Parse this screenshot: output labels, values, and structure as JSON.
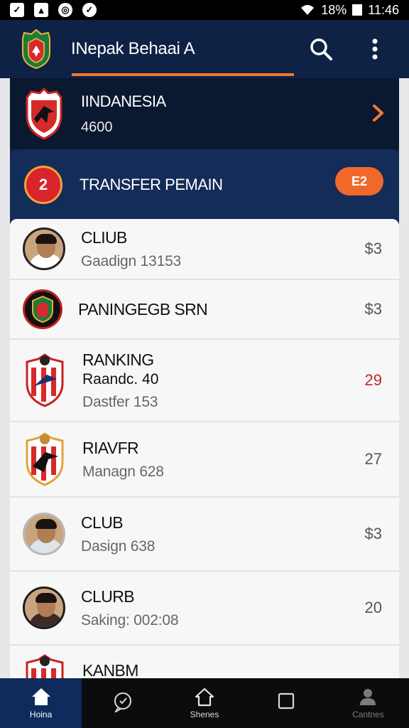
{
  "status_bar": {
    "battery_percent": "18%",
    "time": "11:46"
  },
  "header": {
    "title": "INepak Behaai A",
    "search_icon": "search-icon",
    "menu_icon": "more-vertical-icon"
  },
  "team": {
    "name": "IINDANESIA",
    "value": "4600"
  },
  "transfer": {
    "badge": "2",
    "title": "TRANSFER PEMAIN",
    "pill": "E2"
  },
  "list": {
    "items": [
      {
        "title": "CLIUB",
        "sub": "Gaadign 13153",
        "value": "$3",
        "kind": "avatar",
        "shirt": "#ffffff"
      },
      {
        "title": "PANINGEGB SRN",
        "sub": "",
        "value": "$3",
        "kind": "crest-round"
      },
      {
        "title": "RANKING",
        "sub2": "Raandc. 40",
        "sub": "Dastfer 153",
        "value": "29",
        "kind": "crest-shield",
        "value_color": "red"
      },
      {
        "title": "RIAVFR",
        "sub": "Managn 628",
        "value": "27",
        "kind": "crest-shield"
      },
      {
        "title": "CLUB",
        "sub": "Dasign 638",
        "value": "$3",
        "kind": "avatar",
        "shirt": "#dfe4ea"
      },
      {
        "title": "CLURB",
        "sub": "Saking: 002:08",
        "value": "20",
        "kind": "avatar",
        "shirt": "#3a2a28"
      },
      {
        "title": "KANBM",
        "sub": "",
        "value": "",
        "kind": "crest-shield"
      }
    ]
  },
  "bottom_nav": {
    "items": [
      {
        "label": "Hoina",
        "icon": "home-icon"
      },
      {
        "label": "",
        "icon": "chat-icon"
      },
      {
        "label": "Shenes",
        "icon": "house-outline-icon"
      },
      {
        "label": "",
        "icon": "square-icon"
      },
      {
        "label": "Cantnes",
        "icon": "profile-icon"
      }
    ]
  },
  "colors": {
    "header_bg": "#0e2245",
    "accent_orange": "#f07a2c",
    "transfer_bg": "#132c58",
    "red_value": "#c4262b"
  }
}
